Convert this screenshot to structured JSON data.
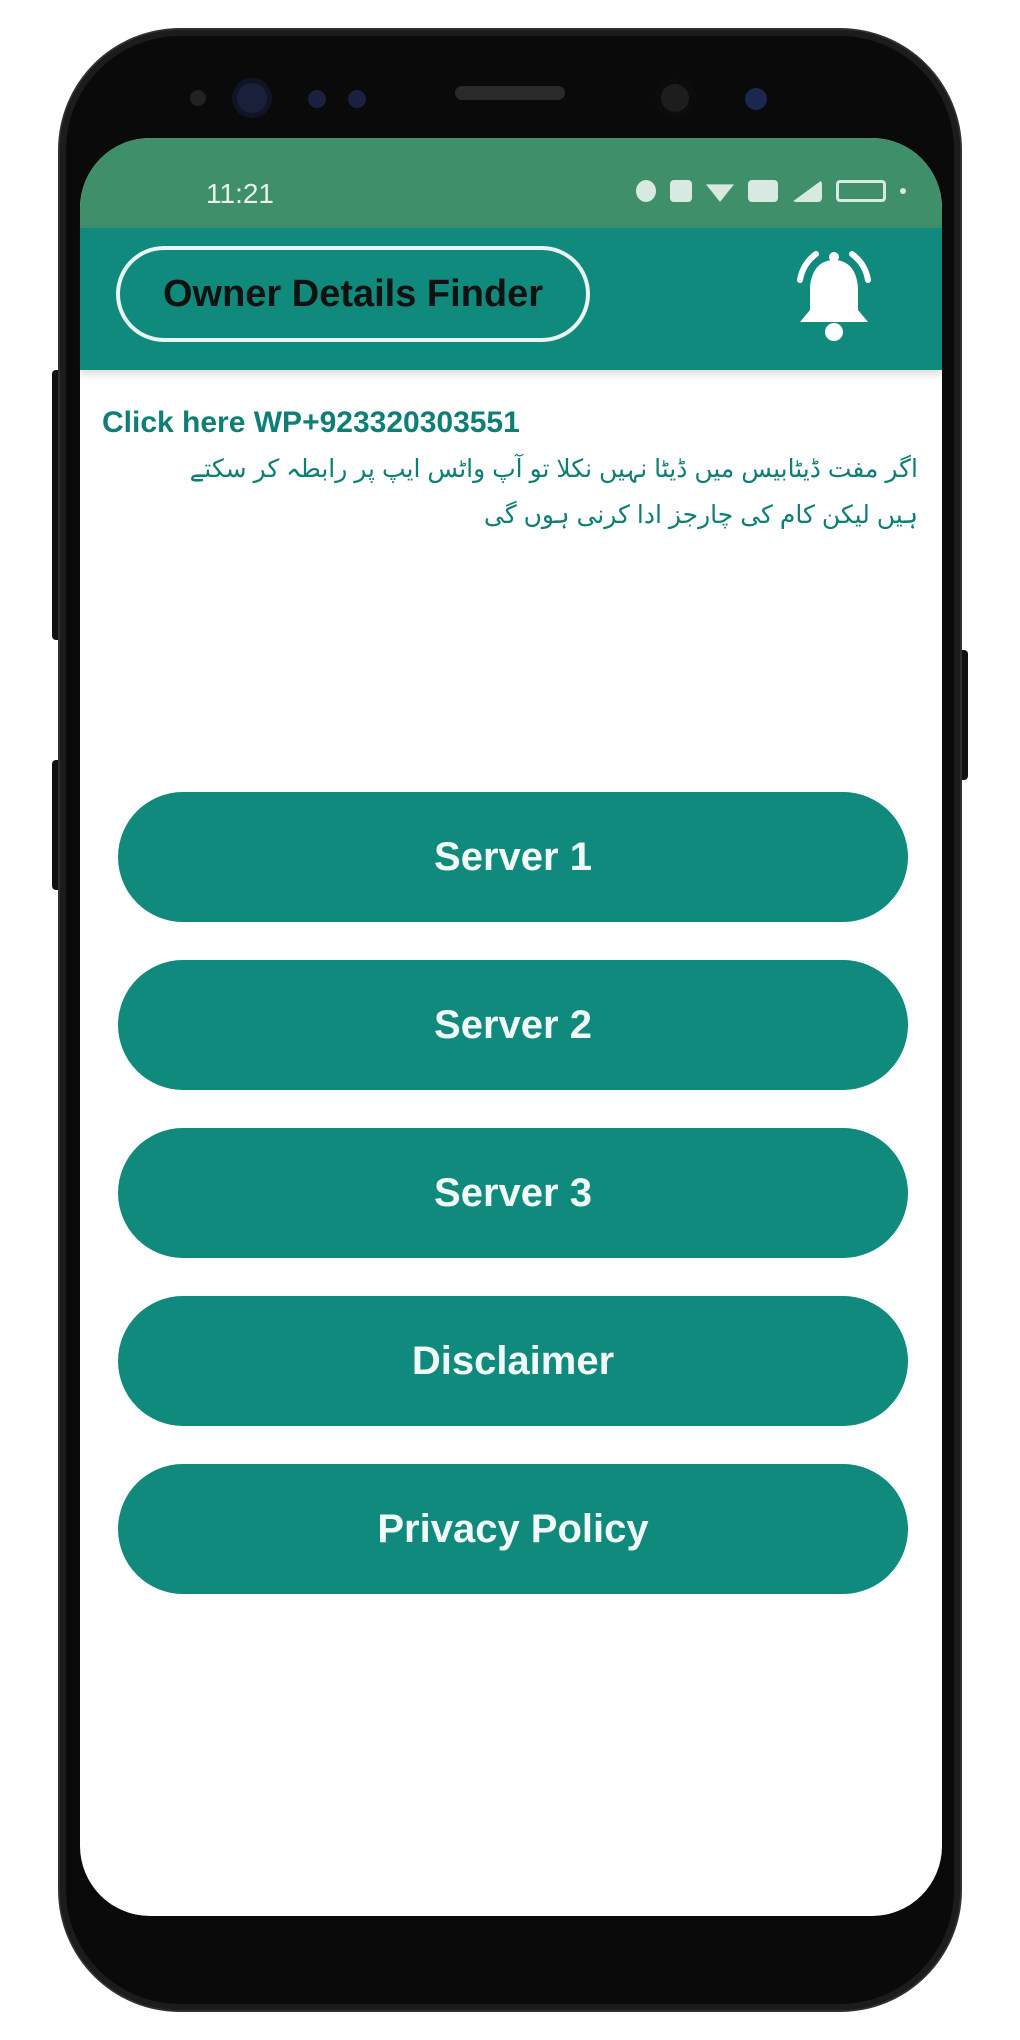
{
  "status_bar": {
    "time": "11:21"
  },
  "app_bar": {
    "title": "Owner Details Finder",
    "notification_icon": "bell-icon"
  },
  "content": {
    "whatsapp_link": "Click here WP+923320303551",
    "urdu_note": "اگر مفت ڈیٹابیس میں ڈیٹا نہیں نکلا تو آپ واٹس ایپ پر رابطہ کر سکتے ہیں لیکن کام کی چارجز ادا کرنی ہوں گی"
  },
  "buttons": [
    {
      "label": "Server 1"
    },
    {
      "label": "Server 2"
    },
    {
      "label": "Server 3"
    },
    {
      "label": "Disclaimer"
    },
    {
      "label": "Privacy Policy"
    }
  ],
  "colors": {
    "status_bar": "#3f8f6b",
    "primary": "#0f8a7c",
    "link_text": "#0f7f75",
    "background": "#ffffff"
  }
}
